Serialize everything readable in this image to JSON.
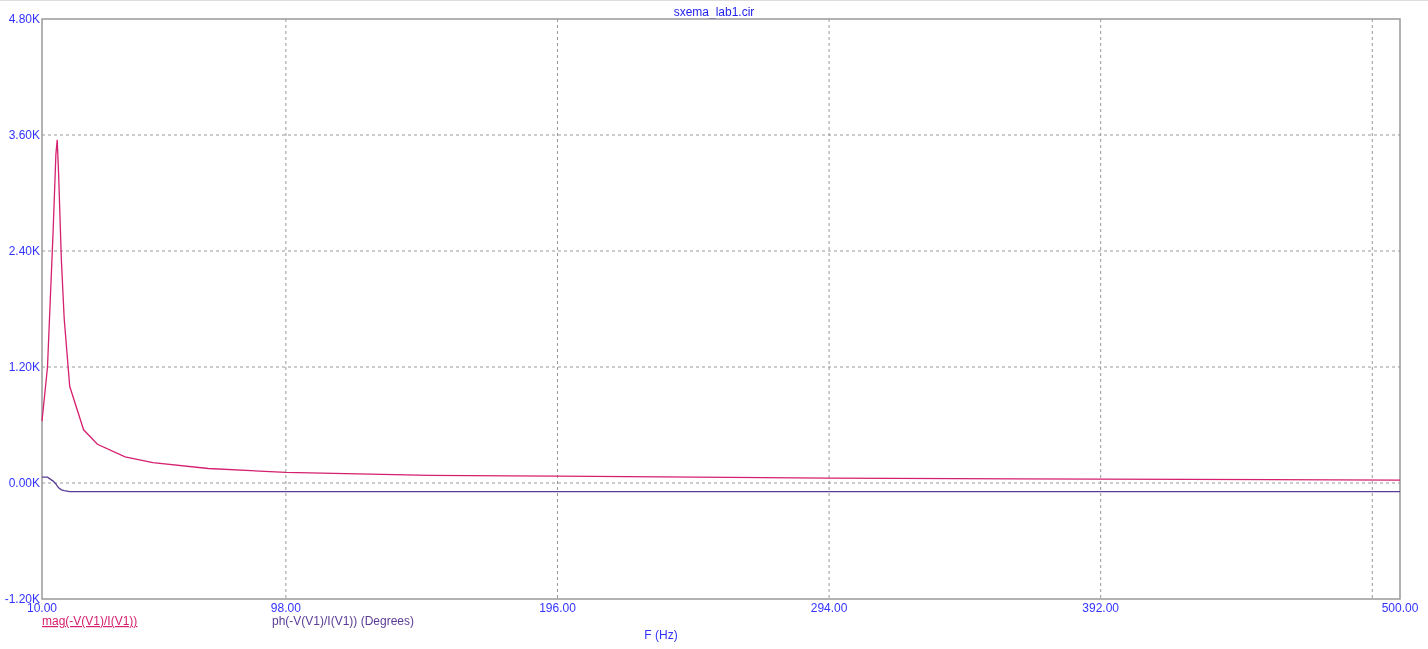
{
  "chart_data": {
    "type": "line",
    "title": "sxema_lab1.cir",
    "xlabel": "F (Hz)",
    "x": [
      10,
      12,
      14,
      15,
      15.5,
      16,
      17,
      18,
      20,
      25,
      30,
      40,
      50,
      70,
      98,
      150,
      196,
      294,
      392,
      500
    ],
    "series": [
      {
        "name": "mag(-V(V1)/I(V1))",
        "color": "#d4206e",
        "values": [
          640,
          1200,
          2600,
          3400,
          3550,
          3200,
          2300,
          1700,
          1000,
          550,
          400,
          270,
          210,
          150,
          110,
          80,
          70,
          50,
          40,
          30
        ]
      },
      {
        "name": "ph(-V(V1)/I(V1)) (Degrees)",
        "color": "#5a3c96",
        "values": [
          60,
          60,
          20,
          -10,
          -30,
          -50,
          -70,
          -80,
          -90,
          -90,
          -90,
          -90,
          -90,
          -90,
          -90,
          -90,
          -90,
          -90,
          -90,
          -90
        ]
      }
    ],
    "grid": true,
    "xlim": [
      10,
      500
    ],
    "ylim": [
      -1200,
      4800
    ],
    "xticks": [
      {
        "value": 10,
        "label": "10.00"
      },
      {
        "value": 98,
        "label": "98.00"
      },
      {
        "value": 196,
        "label": "196.00"
      },
      {
        "value": 294,
        "label": "294.00"
      },
      {
        "value": 392,
        "label": "392.00"
      },
      {
        "value": 500,
        "label": "500.00"
      }
    ],
    "yticks": [
      {
        "value": -1200,
        "label": "-1.20K"
      },
      {
        "value": 0,
        "label": "0.00K"
      },
      {
        "value": 1200,
        "label": "1.20K"
      },
      {
        "value": 2400,
        "label": "2.40K"
      },
      {
        "value": 3600,
        "label": "3.60K"
      },
      {
        "value": 4800,
        "label": "4.80K"
      }
    ]
  },
  "legend": [
    {
      "selected": true
    },
    {
      "selected": false
    }
  ]
}
